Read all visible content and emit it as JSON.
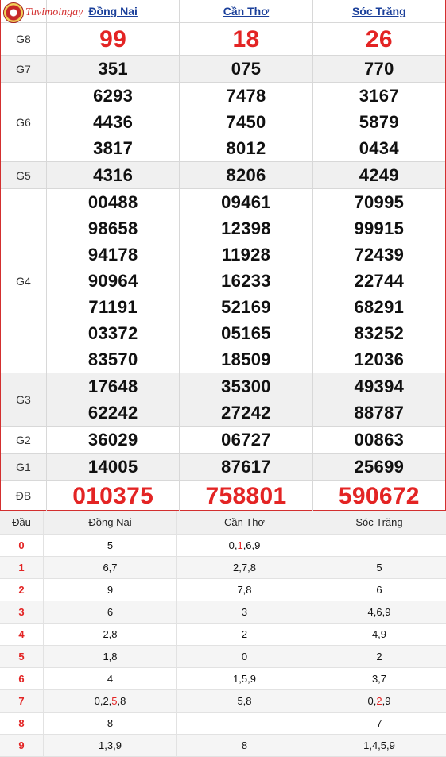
{
  "logo": {
    "text": "Tuvimoingay"
  },
  "provinces": [
    "Đồng Nai",
    "Cần Thơ",
    "Sóc Trăng"
  ],
  "prizes": [
    {
      "label": "G8",
      "values": [
        [
          "99"
        ],
        [
          "18"
        ],
        [
          "26"
        ]
      ]
    },
    {
      "label": "G7",
      "values": [
        [
          "351"
        ],
        [
          "075"
        ],
        [
          "770"
        ]
      ]
    },
    {
      "label": "G6",
      "values": [
        [
          "6293",
          "4436",
          "3817"
        ],
        [
          "7478",
          "7450",
          "8012"
        ],
        [
          "3167",
          "5879",
          "0434"
        ]
      ]
    },
    {
      "label": "G5",
      "values": [
        [
          "4316"
        ],
        [
          "8206"
        ],
        [
          "4249"
        ]
      ]
    },
    {
      "label": "G4",
      "values": [
        [
          "00488",
          "98658",
          "94178",
          "90964",
          "71191",
          "03372",
          "83570"
        ],
        [
          "09461",
          "12398",
          "11928",
          "16233",
          "52169",
          "05165",
          "18509"
        ],
        [
          "70995",
          "99915",
          "72439",
          "22744",
          "68291",
          "83252",
          "12036"
        ]
      ]
    },
    {
      "label": "G3",
      "values": [
        [
          "17648",
          "62242"
        ],
        [
          "35300",
          "27242"
        ],
        [
          "49394",
          "88787"
        ]
      ]
    },
    {
      "label": "G2",
      "values": [
        [
          "36029"
        ],
        [
          "06727"
        ],
        [
          "00863"
        ]
      ]
    },
    {
      "label": "G1",
      "values": [
        [
          "14005"
        ],
        [
          "87617"
        ],
        [
          "25699"
        ]
      ]
    },
    {
      "label": "ĐB",
      "values": [
        [
          "010375"
        ],
        [
          "758801"
        ],
        [
          "590672"
        ]
      ]
    }
  ],
  "loto": {
    "header": [
      "Đầu",
      "Đồng Nai",
      "Cần Thơ",
      "Sóc Trăng"
    ],
    "rows": [
      {
        "dau": "0",
        "cells": [
          [
            {
              "t": "5"
            }
          ],
          [
            {
              "t": "0,"
            },
            {
              "t": "1",
              "red": true
            },
            {
              "t": ",6,9"
            }
          ],
          [
            {
              "t": ""
            }
          ]
        ]
      },
      {
        "dau": "1",
        "cells": [
          [
            {
              "t": "6,7"
            }
          ],
          [
            {
              "t": "2,7,8"
            }
          ],
          [
            {
              "t": "5"
            }
          ]
        ]
      },
      {
        "dau": "2",
        "cells": [
          [
            {
              "t": "9"
            }
          ],
          [
            {
              "t": "7,8"
            }
          ],
          [
            {
              "t": "6"
            }
          ]
        ]
      },
      {
        "dau": "3",
        "cells": [
          [
            {
              "t": "6"
            }
          ],
          [
            {
              "t": "3"
            }
          ],
          [
            {
              "t": "4,6,9"
            }
          ]
        ]
      },
      {
        "dau": "4",
        "cells": [
          [
            {
              "t": "2,8"
            }
          ],
          [
            {
              "t": "2"
            }
          ],
          [
            {
              "t": "4,9"
            }
          ]
        ]
      },
      {
        "dau": "5",
        "cells": [
          [
            {
              "t": "1,8"
            }
          ],
          [
            {
              "t": "0"
            }
          ],
          [
            {
              "t": "2"
            }
          ]
        ]
      },
      {
        "dau": "6",
        "cells": [
          [
            {
              "t": "4"
            }
          ],
          [
            {
              "t": "1,5,9"
            }
          ],
          [
            {
              "t": "3,7"
            }
          ]
        ]
      },
      {
        "dau": "7",
        "cells": [
          [
            {
              "t": "0,2,"
            },
            {
              "t": "5",
              "red": true
            },
            {
              "t": ",8"
            }
          ],
          [
            {
              "t": "5,8"
            }
          ],
          [
            {
              "t": "0,"
            },
            {
              "t": "2",
              "red": true
            },
            {
              "t": ",9"
            }
          ]
        ]
      },
      {
        "dau": "8",
        "cells": [
          [
            {
              "t": "8"
            }
          ],
          [
            {
              "t": ""
            }
          ],
          [
            {
              "t": "7"
            }
          ]
        ]
      },
      {
        "dau": "9",
        "cells": [
          [
            {
              "t": "1,3,9"
            }
          ],
          [
            {
              "t": "8"
            }
          ],
          [
            {
              "t": "1,4,5,9"
            }
          ]
        ]
      }
    ]
  }
}
